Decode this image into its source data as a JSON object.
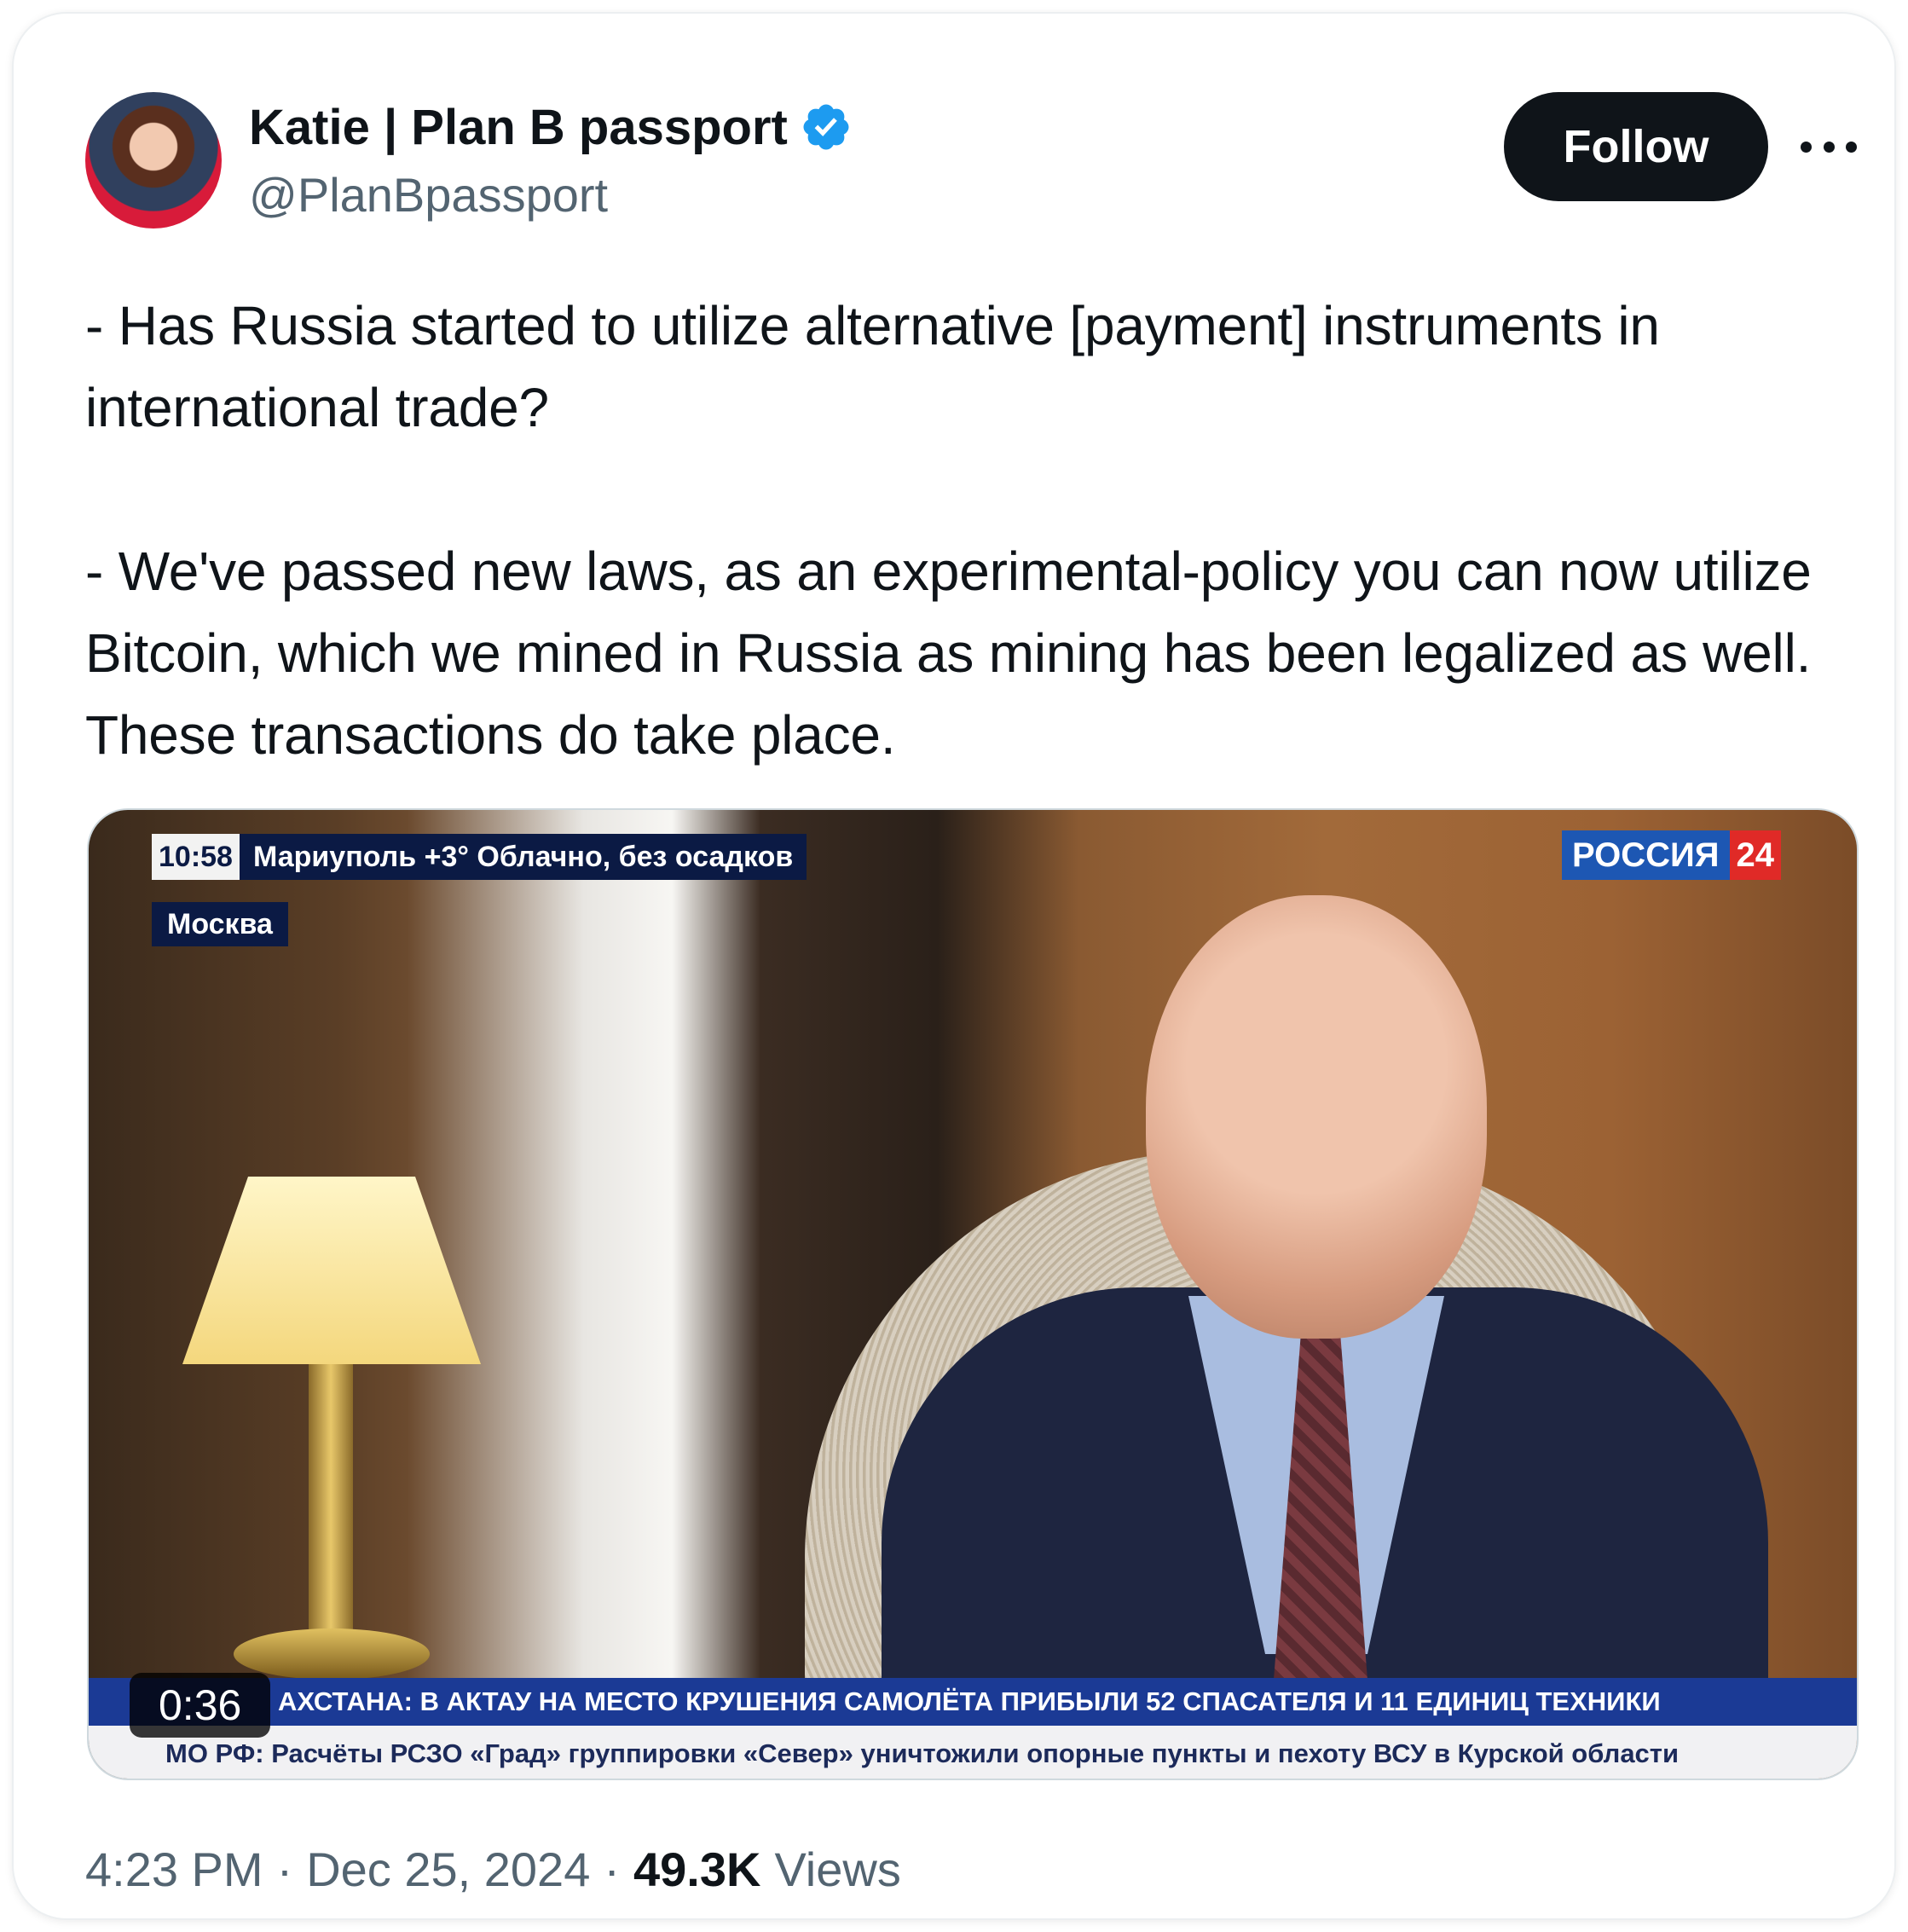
{
  "user": {
    "display_name": "Katie | Plan B passport",
    "handle": "@PlanBpassport",
    "verified": true
  },
  "actions": {
    "follow_label": "Follow",
    "more_icon": "more-horizontal-icon"
  },
  "tweet": {
    "text": "- Has Russia started to utilize alternative [payment] instruments in international trade?\n\n- We've passed new laws, as an experimental-policy you can now utilize Bitcoin, which we mined in Russia as mining has been legalized as well. These transactions do take place."
  },
  "video": {
    "duration": "0:36",
    "overlay": {
      "clock": "10:58",
      "weather": "Мариуполь  +3°  Облачно, без осадков",
      "city": "Москва",
      "channel_a": "РОССИЯ",
      "channel_b": "24",
      "ticker_top": "АХСТАНА: В АКТАУ НА МЕСТО КРУШЕНИЯ САМОЛЁТА ПРИБЫЛИ 52 СПАСАТЕЛЯ И 11 ЕДИНИЦ ТЕХНИКИ",
      "ticker_bottom": "МО РФ: Расчёты РСЗО «Град» группировки «Север» уничтожили опорные пункты и пехоту ВСУ в Курской области"
    }
  },
  "meta": {
    "time": "4:23 PM",
    "sep1": "·",
    "date": "Dec 25, 2024",
    "sep2": "·",
    "views_count": "49.3K",
    "views_label": "Views"
  },
  "colors": {
    "text_primary": "#0f1419",
    "text_secondary": "#536471",
    "verified_blue": "#1d9bf0",
    "follow_bg": "#0f1419"
  }
}
